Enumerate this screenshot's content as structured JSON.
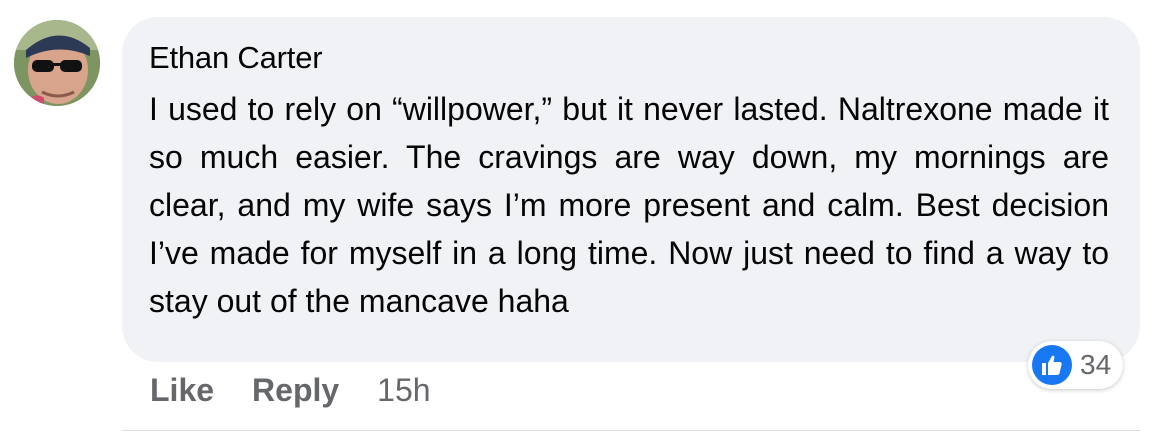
{
  "comment": {
    "author": "Ethan Carter",
    "text": "I used to rely on “willpower,” but it never lasted. Naltrexone made it so much easier. The cravings are way down, my mornings are clear, and my wife says I’m more present and calm. Best decision I’ve made for myself in a long time. Now just need to find a way to stay out of the mancave haha",
    "avatar_icon": "profile-photo"
  },
  "reactions": {
    "icon": "thumbs-up-icon",
    "count": "34",
    "color": "#1877f2"
  },
  "actions": {
    "like_label": "Like",
    "reply_label": "Reply",
    "timestamp": "15h"
  },
  "colors": {
    "bubble": "#f0f2f5",
    "text": "#050505",
    "muted": "#65676b"
  }
}
